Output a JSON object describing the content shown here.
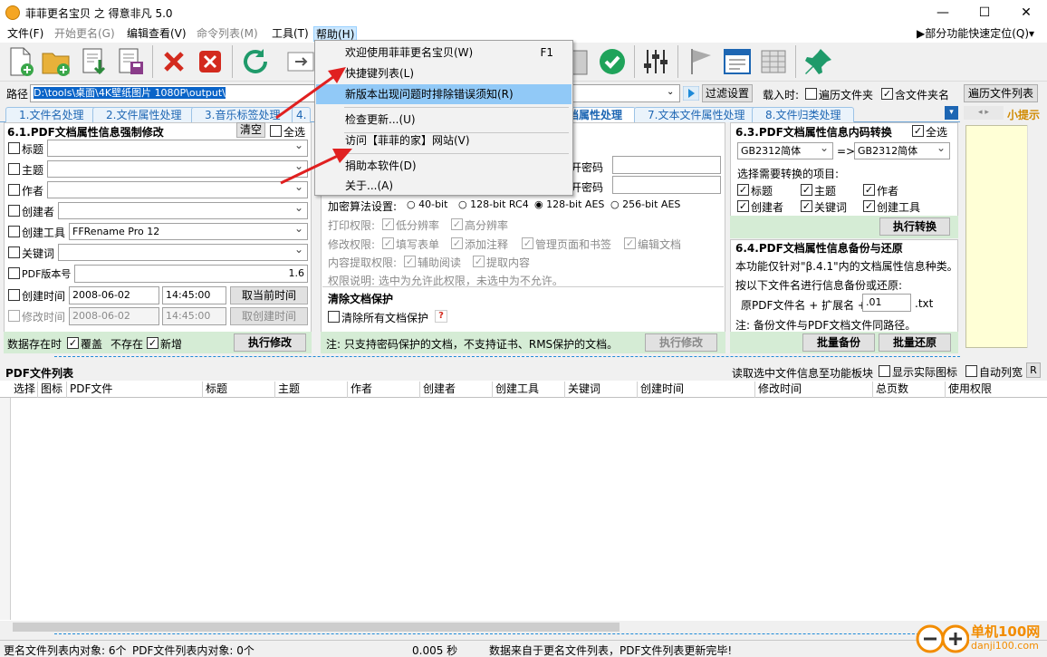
{
  "window": {
    "title": "菲菲更名宝贝 之 得意非凡 5.0",
    "min": "—",
    "max": "☐",
    "close": "✕"
  },
  "menubar": {
    "items": [
      "文件(F)",
      "开始更名(G)",
      "编辑查看(V)",
      "命令列表(M)",
      "工具(T)",
      "帮助(H)"
    ],
    "right": "▶部分功能快速定位(Q)▾"
  },
  "help_menu": {
    "items": [
      {
        "label": "欢迎使用菲菲更名宝贝(W)",
        "shortcut": "F1"
      },
      {
        "label": "快捷键列表(L)"
      },
      {
        "label": "新版本出现问题时排除错误须知(R)"
      },
      {
        "label": "检查更新...(U)"
      },
      {
        "label": "访问【菲菲的家】网站(V)"
      },
      {
        "label": "捐助本软件(D)"
      },
      {
        "label": "关于...(A)"
      }
    ]
  },
  "path": {
    "label": "路径",
    "value": "D:\\tools\\桌面\\4K壁纸图片 1080P\\output\\",
    "filter": "过滤设置",
    "load_label": "载入时:",
    "traverse_sub": "遍历文件夹",
    "include_folder": "含文件夹名",
    "traverse_list": "遍历文件列表"
  },
  "tabs": [
    "1.文件名处理",
    "2.文件属性处理",
    "3.音乐标签处理",
    "4.",
    "档属性处理",
    "7.文本文件属性处理",
    "8.文件归类处理"
  ],
  "tip": "小提示",
  "p61": {
    "title": "6.1.PDF文档属性信息强制修改",
    "clear": "清空",
    "all": "全选",
    "fields": [
      "标题",
      "主题",
      "作者",
      "创建者",
      "创建工具",
      "关键词",
      "PDF版本号",
      "创建时间",
      "修改时间"
    ],
    "tool_value": "FFRename Pro 12",
    "version_value": "1.6",
    "ctime_date": "2008-06-02",
    "ctime_time": "14:45:00",
    "mtime_date": "2008-06-02",
    "mtime_time": "14:45:00",
    "btn_now": "取当前时间",
    "btn_create": "取创建时间",
    "footer_exist": "数据存在时",
    "overwrite": "覆盖",
    "not_exist": "不存在",
    "add": "新增",
    "exec": "执行修改"
  },
  "p62": {
    "open_pwd1": "开密码",
    "open_pwd2": "开密码",
    "enc_label": "加密算法设置:",
    "enc": [
      "40-bit",
      "128-bit RC4",
      "128-bit AES",
      "256-bit AES"
    ],
    "print": "打印权限:",
    "print_low": "低分辨率",
    "print_high": "高分辨率",
    "modify": "修改权限:",
    "fill": "填写表单",
    "annot": "添加注释",
    "manage": "管理页面和书签",
    "edit": "编辑文档",
    "extract": "内容提取权限:",
    "assist": "辅助阅读",
    "extract_c": "提取内容",
    "perm_note": "权限说明: 选中为允许此权限，未选中为不允许。",
    "remove_title": "清除文档保护",
    "remove_all": "清除所有文档保护",
    "help": "?",
    "footer": "注: 只支持密码保护的文档，不支持证书、RMS保护的文档。",
    "exec": "执行修改"
  },
  "p63": {
    "title": "6.3.PDF文档属性信息内码转换",
    "all": "全选",
    "from": "GB2312简体",
    "arrow": "=>",
    "to": "GB2312简体",
    "choose": "选择需要转换的项目:",
    "items": [
      "标题",
      "主题",
      "作者",
      "创建者",
      "关键词",
      "创建工具"
    ],
    "exec": "执行转换"
  },
  "p64": {
    "title": "6.4.PDF文档属性信息备份与还原",
    "desc": "本功能仅针对\"β.4.1\"内的文档属性信息种类。",
    "desc2": "按以下文件名进行信息备份或还原:",
    "name_label": "原PDF文件名 + 扩展名 +",
    "ext_value": ".01",
    "ext_suffix": ".txt",
    "note": "注: 备份文件与PDF文档文件同路径。",
    "backup": "批量备份",
    "restore": "批量还原"
  },
  "list": {
    "title": "PDF文件列表",
    "read": "读取选中文件信息至功能板块",
    "show_icon": "显示实际图标",
    "auto_col": "自动列宽",
    "r": "R",
    "columns": [
      "选择",
      "图标",
      "PDF文件",
      "标题",
      "主题",
      "作者",
      "创建者",
      "创建工具",
      "关键词",
      "创建时间",
      "修改时间",
      "总页数",
      "使用权限"
    ]
  },
  "status": {
    "a": "更名文件列表内对象: 6个",
    "b": "PDF文件列表内对象: 0个",
    "c": "0.005 秒",
    "d": "数据来自于更名文件列表，PDF文件列表更新完毕!",
    "watermark": "单机100网",
    "watermark_url": "danji100.com"
  }
}
